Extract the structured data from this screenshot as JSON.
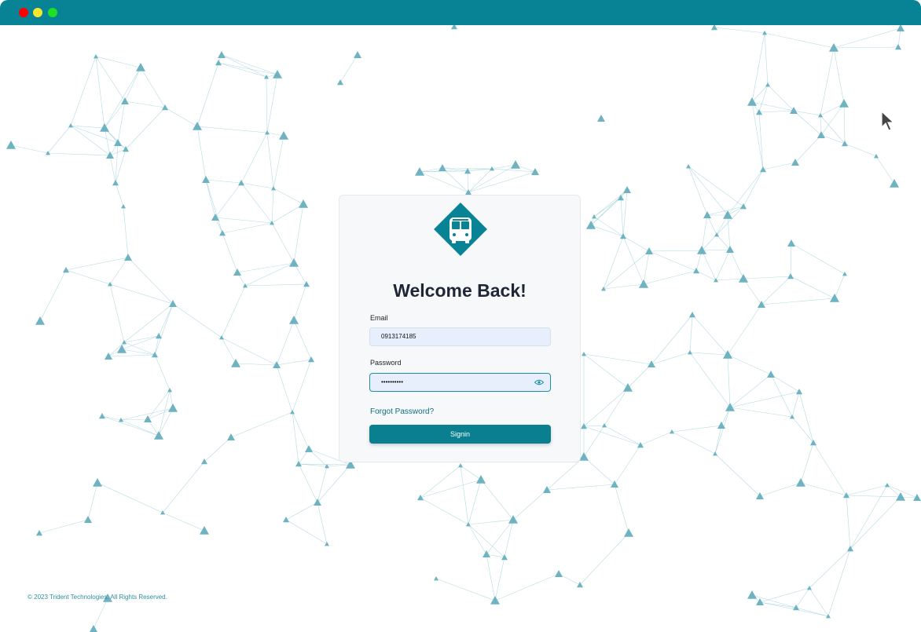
{
  "window": {
    "title_bar_color": "#088395"
  },
  "colors": {
    "accent": "#0a7f8f",
    "node": "#6fb3c2",
    "edge": "#9ccfd8"
  },
  "login": {
    "logo_icon": "bus-icon",
    "title": "Welcome Back!",
    "email_label": "Email",
    "email_value": "0913174185",
    "password_label": "Password",
    "password_value": "••••••••••",
    "forgot_password": "Forgot Password?",
    "signin_button": "Signin"
  },
  "footer": {
    "copyright": "© 2023 Trident Technologies. All Rights Reserved."
  }
}
